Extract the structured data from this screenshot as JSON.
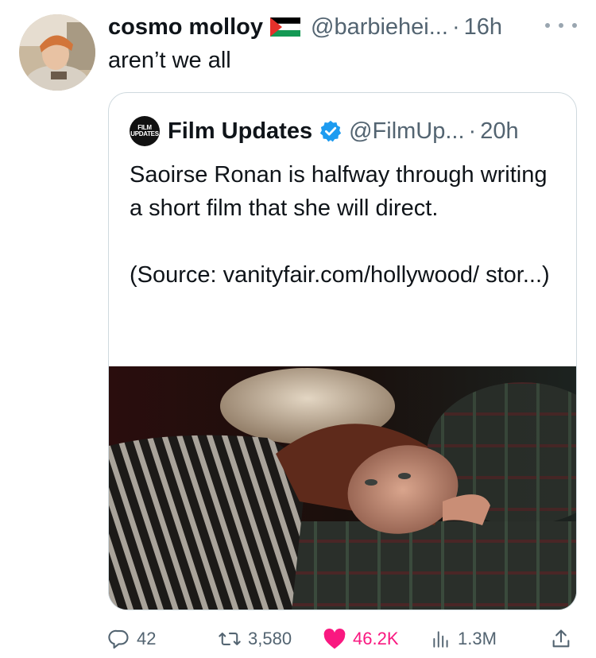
{
  "tweet": {
    "author_name": "cosmo molloy",
    "handle": "@barbiehei...",
    "separator": "·",
    "time": "16h",
    "text": "aren’t we all"
  },
  "quoted": {
    "logo_text_top": "FILM",
    "logo_text_bottom": "UPDATES",
    "author_name": "Film Updates",
    "handle": "@FilmUp...",
    "separator": "·",
    "time": "20h",
    "body_line1": "Saoirse Ronan is halfway through writing a short film that she will direct.",
    "body_line2": "(Source: vanityfair.com/hollywood/ stor...)"
  },
  "actions": {
    "replies": "42",
    "reposts": "3,580",
    "likes": "46.2K",
    "views": "1.3M"
  },
  "icons": {
    "reply": "speech-bubble-icon",
    "repost": "repost-arrows-icon",
    "like": "heart-icon",
    "views": "bar-chart-icon",
    "share": "share-upload-icon",
    "more": "more-dots-icon",
    "verified": "verified-badge-icon",
    "flag": "palestine-flag-icon"
  },
  "colors": {
    "secondary_text": "#536471",
    "like": "#f91880",
    "verified": "#1d9bf0",
    "border": "#cfd9de"
  }
}
